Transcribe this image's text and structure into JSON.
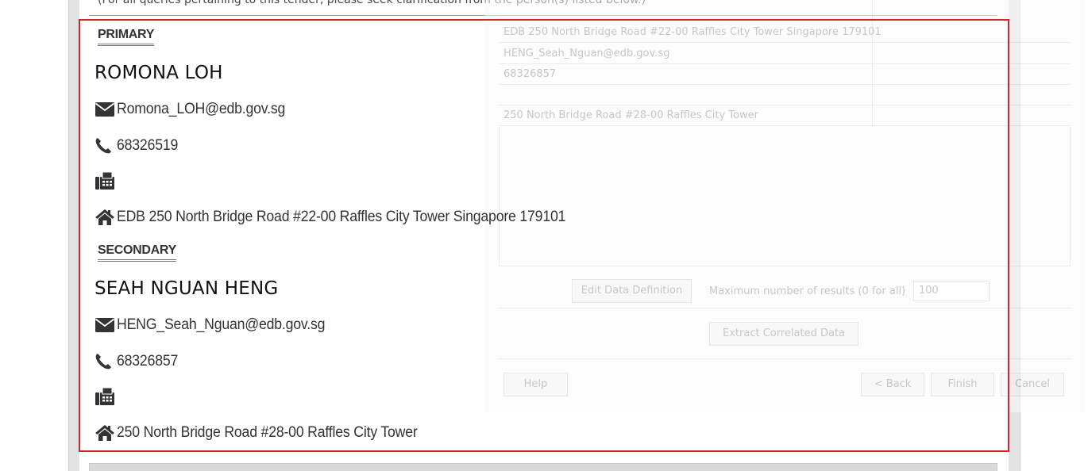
{
  "note_text": "(For all queries pertaining to this tender, please seek clarification from the person(s) listed below.)",
  "colors": {
    "frame": "#d9232a",
    "rule": "#e08a2a"
  },
  "background_dialog": {
    "rows": [
      "EDB 250 North Bridge Road #22-00 Raffles City Tower Singapore 179101",
      "HENG_Seah_Nguan@edb.gov.sg",
      "68326857",
      "",
      "250 North Bridge Road #28-00 Raffles City Tower"
    ],
    "edit_button": "Edit Data Definition",
    "max_results_label": "Maximum number of results (0 for all)",
    "max_results_value": "100",
    "extract_button": "Extract Correlated Data",
    "help_button": "Help",
    "back_button": "< Back",
    "finish_button": "Finish",
    "cancel_button": "Cancel"
  },
  "contacts": {
    "primary": {
      "label": "PRIMARY",
      "name": "ROMONA LOH",
      "email": "Romona_LOH@edb.gov.sg",
      "phone": "68326519",
      "fax": "",
      "address": "EDB 250 North Bridge Road #22-00 Raffles City Tower Singapore 179101"
    },
    "secondary": {
      "label": "SECONDARY",
      "name": "SEAH NGUAN HENG",
      "email": "HENG_Seah_Nguan@edb.gov.sg",
      "phone": "68326857",
      "fax": "",
      "address": "250 North Bridge Road #28-00 Raffles City Tower"
    }
  },
  "icons": {
    "email": "envelope-icon",
    "phone": "phone-icon",
    "fax": "fax-icon",
    "address": "home-icon"
  }
}
